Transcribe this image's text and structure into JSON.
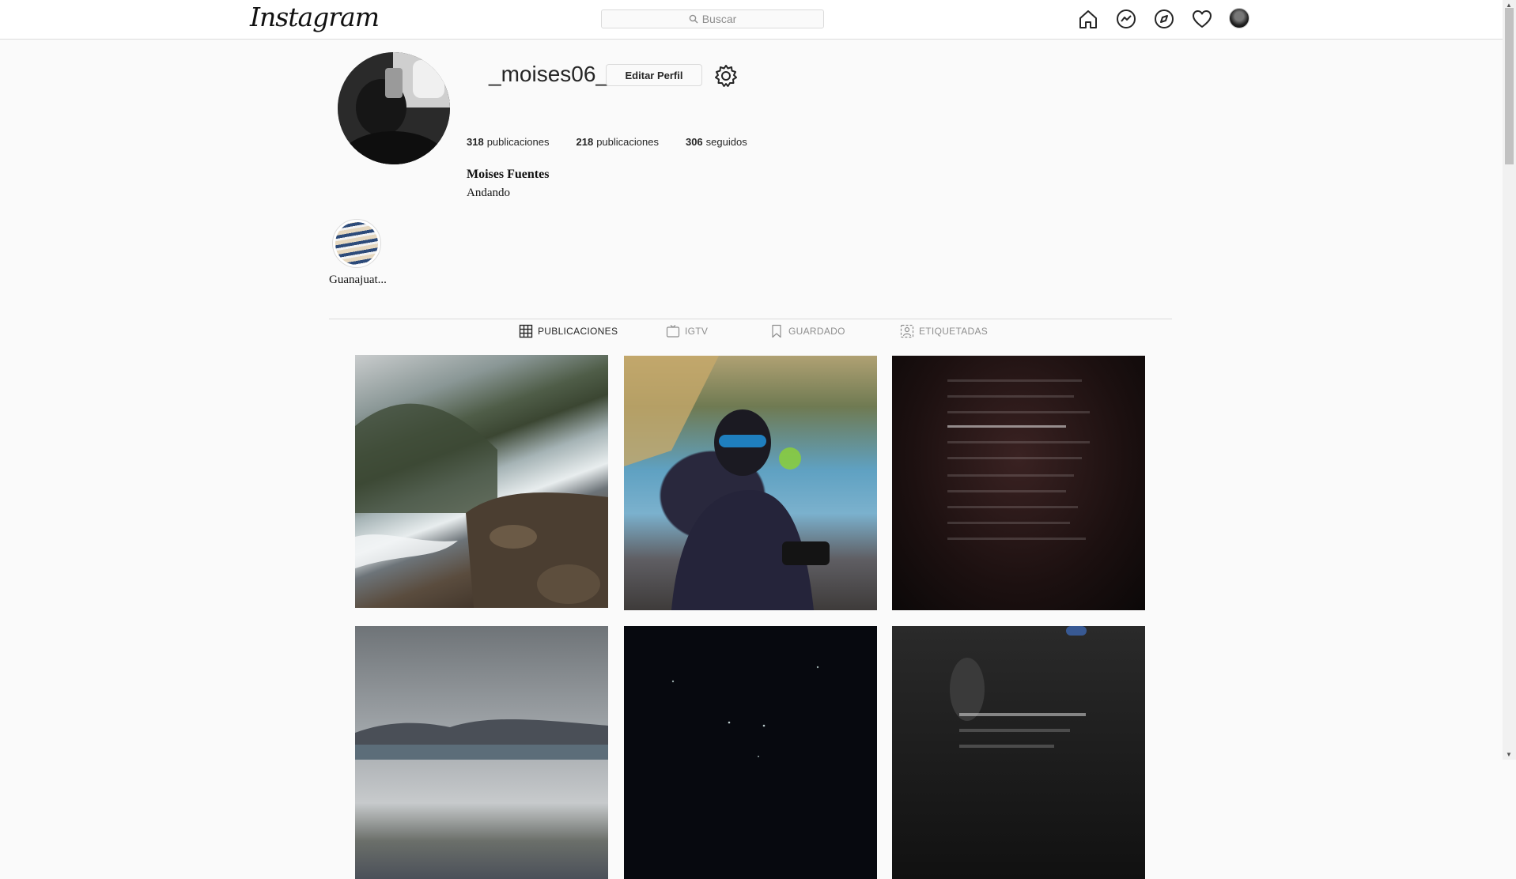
{
  "header": {
    "logo": "Instagram",
    "search_placeholder": "Buscar",
    "nav_icons": [
      "home-icon",
      "messenger-icon",
      "explore-icon",
      "heart-icon",
      "avatar"
    ]
  },
  "profile": {
    "username": "_moises06_",
    "edit_button": "Editar Perfil",
    "stats": [
      {
        "count": "318",
        "label": "publicaciones"
      },
      {
        "count": "218",
        "label": "publicaciones"
      },
      {
        "count": "306",
        "label": "seguidos"
      }
    ],
    "full_name": "Moises Fuentes",
    "bio": "Andando"
  },
  "highlights": [
    {
      "label": "Guanajuat..."
    }
  ],
  "tabs": [
    {
      "label": "PUBLICACIONES",
      "icon": "grid-icon",
      "active": true
    },
    {
      "label": "IGTV",
      "icon": "tv-icon",
      "active": false
    },
    {
      "label": "GUARDADO",
      "icon": "bookmark-icon",
      "active": false
    },
    {
      "label": "ETIQUETADAS",
      "icon": "tagged-user-icon",
      "active": false
    }
  ],
  "posts_count_visible": 6
}
